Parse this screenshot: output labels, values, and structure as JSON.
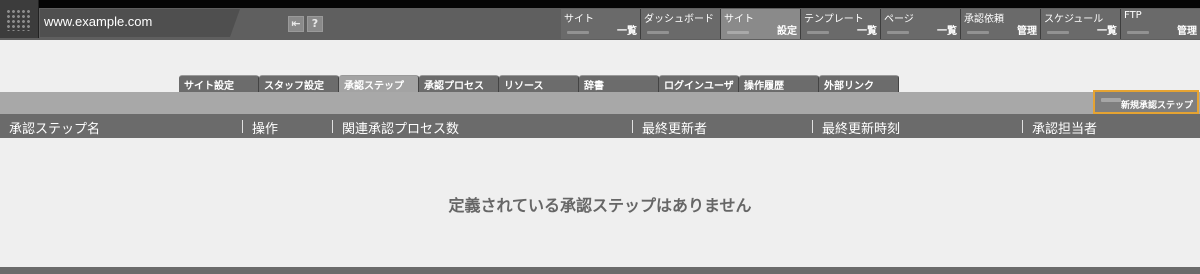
{
  "header": {
    "site": "www.example.com",
    "buttons": {
      "back_icon": "arrow-left-icon",
      "help_label": "?"
    }
  },
  "top_menu": [
    {
      "label": "サイト",
      "sub": "一覧",
      "active": false
    },
    {
      "label": "ダッシュボード",
      "sub": "",
      "active": false
    },
    {
      "label": "サイト",
      "sub": "設定",
      "active": true
    },
    {
      "label": "テンプレート",
      "sub": "一覧",
      "active": false
    },
    {
      "label": "ページ",
      "sub": "一覧",
      "active": false
    },
    {
      "label": "承認依頼",
      "sub": "管理",
      "active": false
    },
    {
      "label": "スケジュール",
      "sub": "一覧",
      "active": false
    },
    {
      "label": "FTP",
      "sub": "管理",
      "active": false
    }
  ],
  "tabs": [
    {
      "label": "サイト設定",
      "active": false
    },
    {
      "label": "スタッフ設定",
      "active": false
    },
    {
      "label": "承認ステップ",
      "active": true
    },
    {
      "label": "承認プロセス",
      "active": false
    },
    {
      "label": "リソース",
      "active": false
    },
    {
      "label": "辞書",
      "active": false
    },
    {
      "label": "ログインユーザ",
      "active": false
    },
    {
      "label": "操作履歴",
      "active": false
    },
    {
      "label": "外部リンク",
      "active": false
    }
  ],
  "actions": {
    "new_step": "新規承認ステップ"
  },
  "table": {
    "columns": [
      "承認ステップ名",
      "操作",
      "関連承認プロセス数",
      "最終更新者",
      "最終更新時刻",
      "承認担当者"
    ]
  },
  "empty_message": "定義されている承認ステップはありません",
  "colors": {
    "highlight": "#e5a332",
    "header_bg": "#5f5f5f",
    "table_header": "#6b6b6b"
  }
}
